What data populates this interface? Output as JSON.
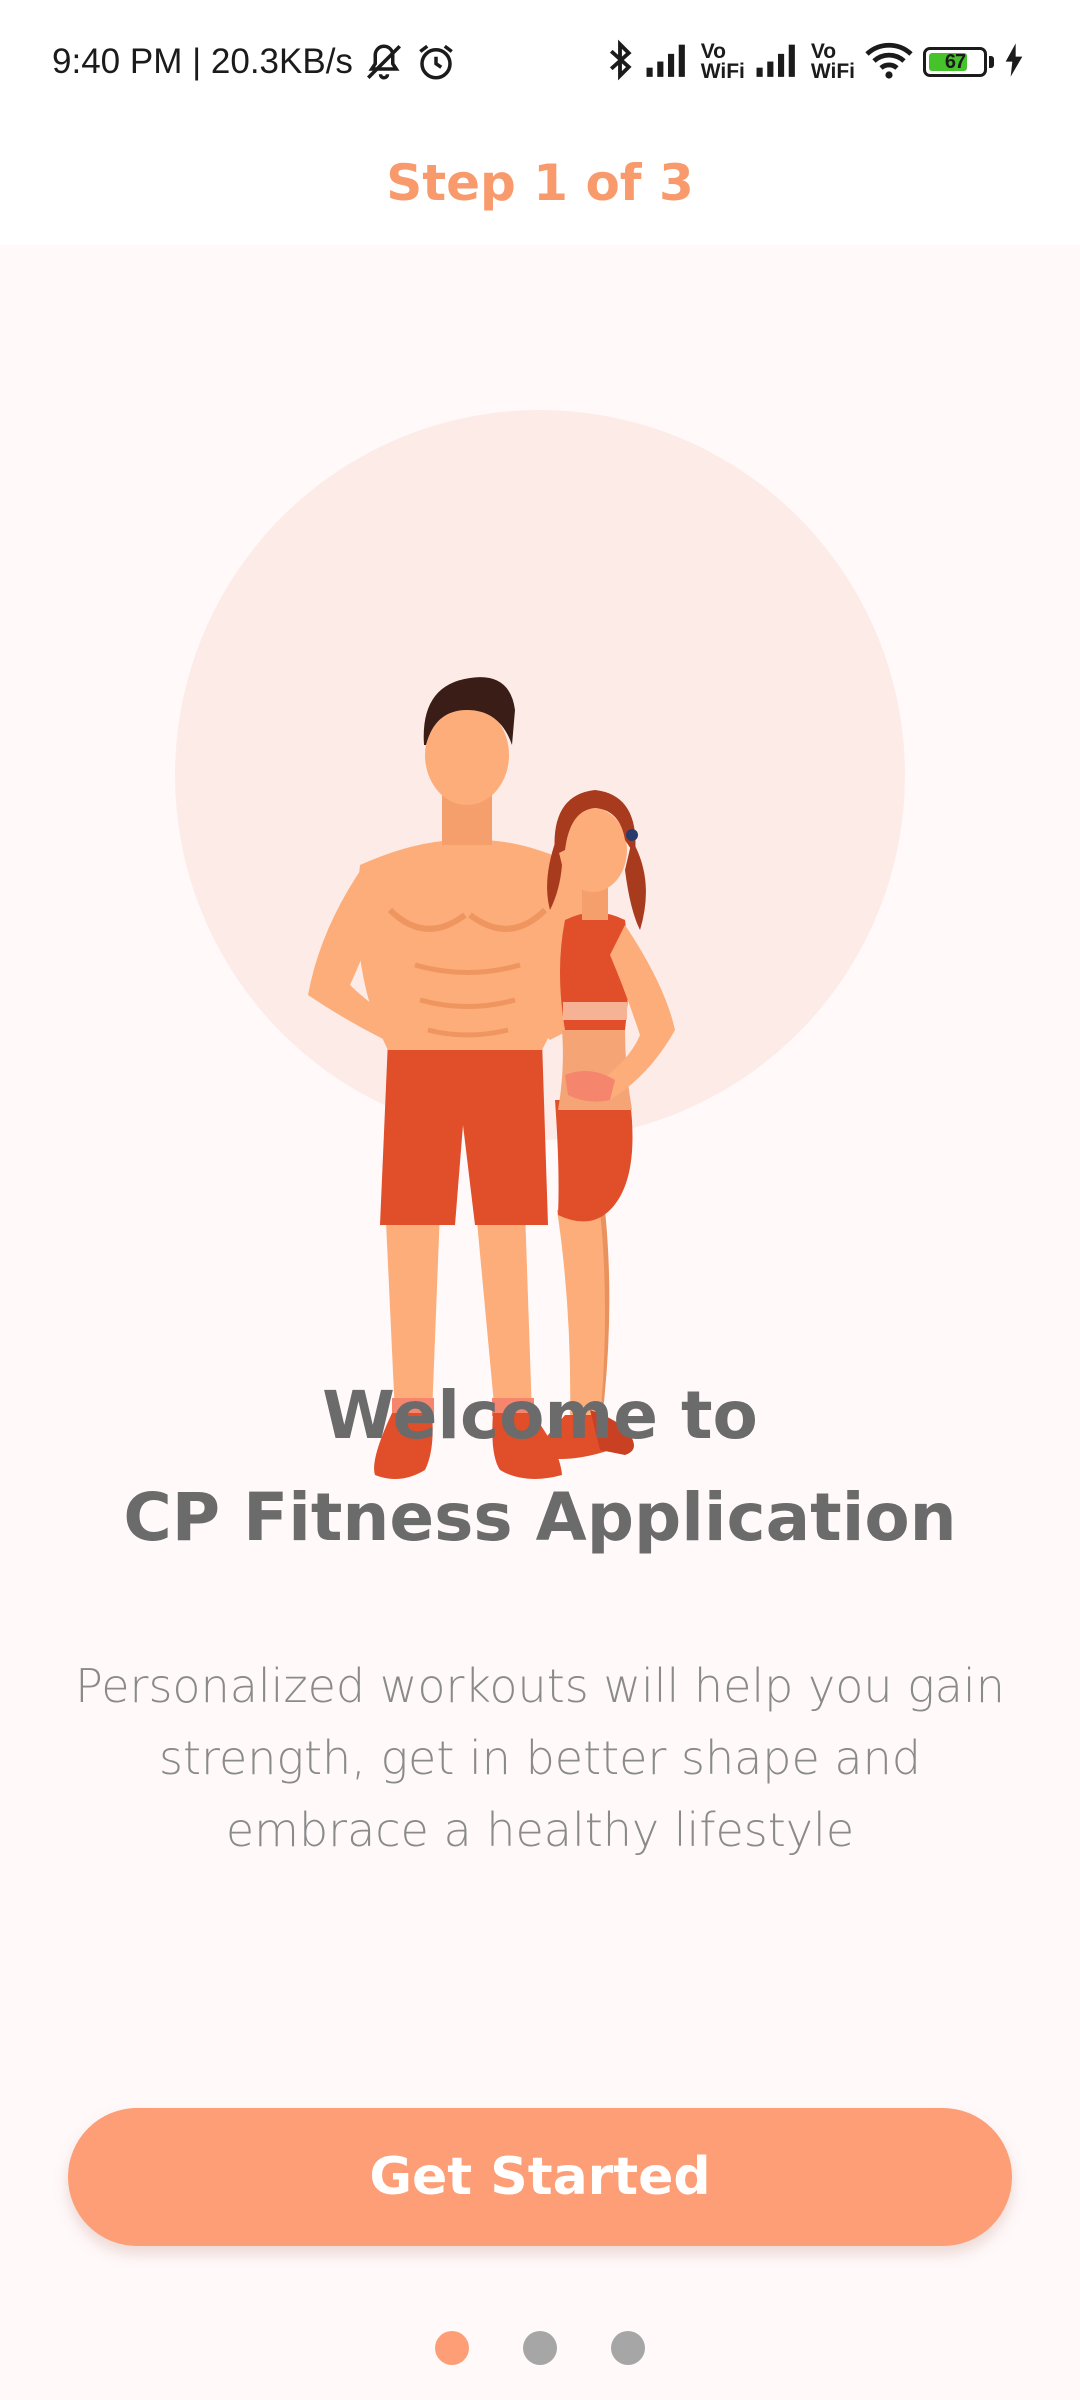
{
  "status_bar": {
    "time_speed": "9:40 PM | 20.3KB/s",
    "vowifi_1": [
      "Vo",
      "WiFi"
    ],
    "vowifi_2": [
      "Vo",
      "WiFi"
    ],
    "battery_level": "67",
    "icons": [
      "bell-off-icon",
      "alarm-icon",
      "bluetooth-icon",
      "signal-icon",
      "signal-icon",
      "wifi-icon",
      "battery-icon",
      "charging-icon"
    ]
  },
  "header": {
    "step_label": "Step 1 of 3"
  },
  "welcome": {
    "title_line1": "Welcome to",
    "title_line2": "CP Fitness Application",
    "description": "Personalized workouts will help you gain strength, get in better shape and embrace a healthy lifestyle"
  },
  "actions": {
    "get_started_label": "Get Started"
  },
  "pagination": {
    "total": 3,
    "current": 1
  },
  "colors": {
    "accent": "#fd9e76",
    "step_text": "#f89a6c",
    "title_text": "#6b6b6b",
    "body_text": "#8a8a8a",
    "background": "#fff9fa",
    "inactive_dot": "#a6a6a6"
  }
}
